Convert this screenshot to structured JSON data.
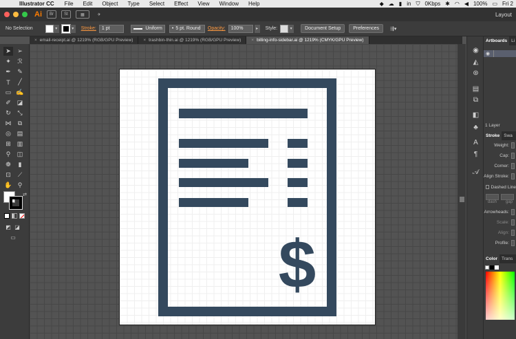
{
  "menubar": {
    "app_name": "Illustrator CC",
    "menus": [
      "File",
      "Edit",
      "Object",
      "Type",
      "Select",
      "Effect",
      "View",
      "Window",
      "Help"
    ],
    "network_speed": "0Kbps",
    "battery": "100%",
    "clock": "Fri 2"
  },
  "appbar": {
    "logo": "Ai",
    "bridge_label": "Br",
    "stock_label": "St",
    "workspace": "Layout"
  },
  "control": {
    "selection": "No Selection",
    "stroke_label": "Stroke:",
    "stroke_weight": "1 pt",
    "profile": "Uniform",
    "brush": "5 pt. Round",
    "opacity_label": "Opacity:",
    "opacity_value": "100%",
    "style_label": "Style:",
    "document_setup": "Document Setup",
    "preferences": "Preferences"
  },
  "tabs": [
    {
      "label": "email-receipt.ai @ 1219% (RGB/GPU Preview)",
      "active": false
    },
    {
      "label": "trashbin-thin.ai @ 1219% (RGB/GPU Preview)",
      "active": false
    },
    {
      "label": "billing-info-sidebar.ai @ 1219% (CMYK/GPU Preview)",
      "active": true
    }
  ],
  "panels": {
    "top_tabs": [
      "Artboards",
      "Li"
    ],
    "layer_count": "1 Layer",
    "stroke_tabs": [
      "Stroke",
      "Swa"
    ],
    "stroke_rows": [
      "Weight:",
      "Cap:",
      "Corner:",
      "Align Stroke:"
    ],
    "dashed_line": "Dashed Line",
    "dash_labels": [
      "dash",
      "gap"
    ],
    "arrowheads": "Arrowheads:",
    "scale": "Scale:",
    "align": "Align:",
    "profile": "Profile:",
    "color_tabs": [
      "Color",
      "Trans"
    ]
  },
  "colors": {
    "icon_fill": "#34495e",
    "accent_orange": "#ff7c00",
    "traffic_red": "#fc605c",
    "traffic_yellow": "#fdbc40",
    "traffic_green": "#34c84a"
  },
  "artwork": {
    "currency_symbol": "$"
  }
}
